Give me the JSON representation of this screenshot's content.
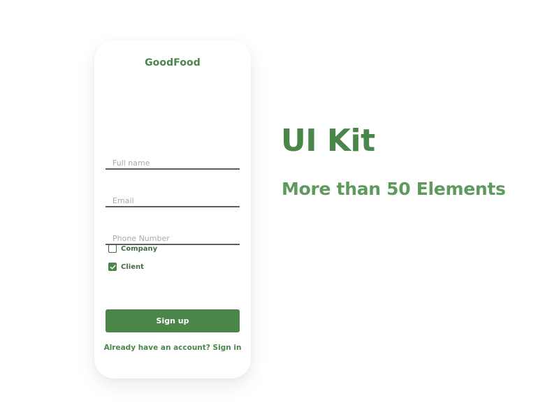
{
  "colors": {
    "primary_green": "#4a8549",
    "light_green": "#5f9a5d",
    "underline": "#5e5e5e",
    "placeholder": "#a9a9a9",
    "background": "#ffffff"
  },
  "app": {
    "title": "GoodFood"
  },
  "form": {
    "full_name": {
      "value": "",
      "placeholder": "Full name"
    },
    "email": {
      "value": "",
      "placeholder": "Email"
    },
    "phone": {
      "value": "",
      "placeholder": "Phone Number"
    }
  },
  "checkboxes": [
    {
      "label": "Company",
      "checked": false
    },
    {
      "label": "Client",
      "checked": true
    }
  ],
  "signup_button": {
    "label": "Sign up"
  },
  "signin_link": {
    "label": "Already have an account? Sign in"
  },
  "hero": {
    "title": "UI Kit",
    "subtitle": "More than 50 Elements"
  },
  "icons": {
    "checkmark": "checkmark-icon"
  }
}
